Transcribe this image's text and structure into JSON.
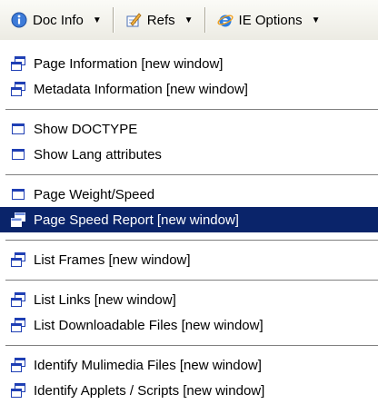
{
  "toolbar": {
    "doc_info": {
      "label": "Doc Info",
      "icon": "doc-info-icon"
    },
    "refs": {
      "label": "Refs",
      "icon": "refs-icon"
    },
    "ie_options": {
      "label": "IE Options",
      "icon": "ie-icon"
    }
  },
  "menu": {
    "items": [
      {
        "label": "Page Information [new window]",
        "icon": "new-window-icon"
      },
      {
        "label": "Metadata Information [new window]",
        "icon": "new-window-icon"
      },
      {
        "label": "Show DOCTYPE",
        "icon": "window-icon"
      },
      {
        "label": "Show Lang attributes",
        "icon": "window-icon"
      },
      {
        "label": "Page Weight/Speed",
        "icon": "window-icon"
      },
      {
        "label": "Page Speed Report [new window]",
        "icon": "new-window-icon",
        "selected": true
      },
      {
        "label": "List Frames [new window]",
        "icon": "new-window-icon"
      },
      {
        "label": "List Links [new window]",
        "icon": "new-window-icon"
      },
      {
        "label": "List Downloadable Files [new window]",
        "icon": "new-window-icon"
      },
      {
        "label": "Identify Mulimedia Files [new window]",
        "icon": "new-window-icon"
      },
      {
        "label": "Identify Applets / Scripts [new window]",
        "icon": "new-window-icon"
      }
    ]
  },
  "colors": {
    "selection_bg": "#0a246a",
    "selection_fg": "#ffffff",
    "icon_blue": "#1f3fb4",
    "toolbar_bg": "#f1efe6"
  }
}
